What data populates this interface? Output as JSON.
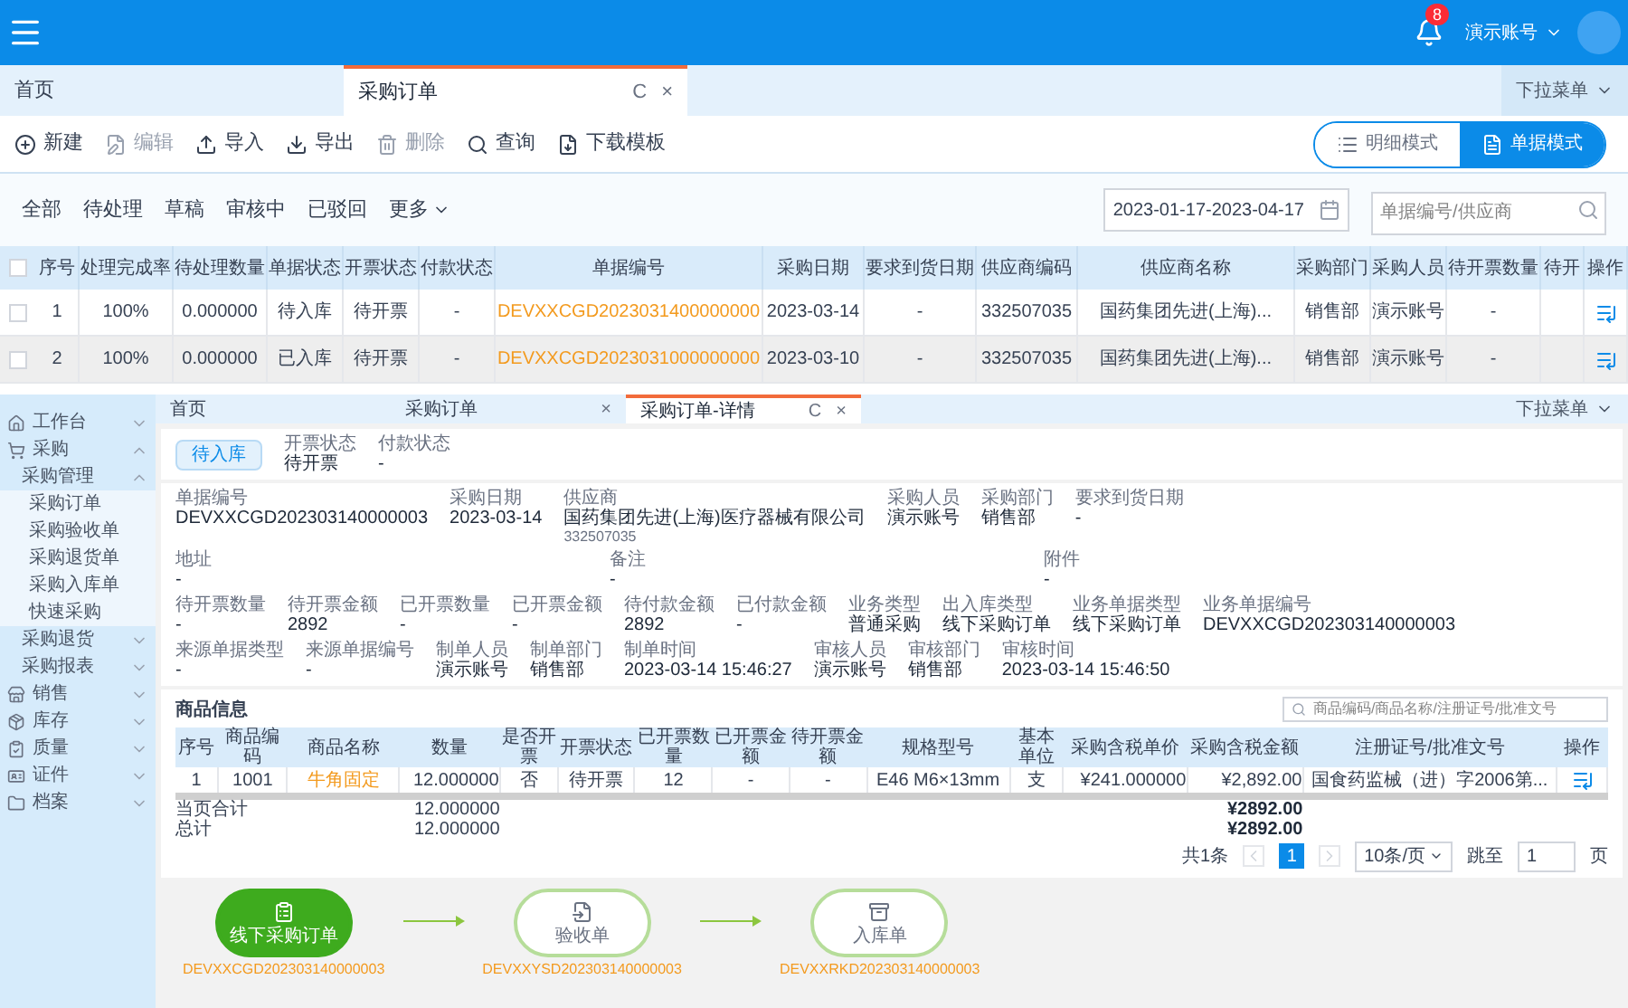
{
  "header": {
    "notification_count": "8",
    "user": "演示账号"
  },
  "tabs": [
    {
      "label": "首页",
      "selected": false
    },
    {
      "label": "采购订单",
      "selected": true,
      "refresh": "C",
      "close": "×"
    }
  ],
  "tab_menu": "下拉菜单",
  "toolbar": [
    {
      "label": "新建",
      "disabled": false
    },
    {
      "label": "编辑",
      "disabled": true
    },
    {
      "label": "导入",
      "disabled": false
    },
    {
      "label": "导出",
      "disabled": false
    },
    {
      "label": "删除",
      "disabled": true
    },
    {
      "label": "查询",
      "disabled": false
    },
    {
      "label": "下载模板",
      "disabled": false
    }
  ],
  "view_modes": [
    {
      "label": "明细模式",
      "selected": false
    },
    {
      "label": "单据模式",
      "selected": true
    }
  ],
  "filters": [
    {
      "label": "全部",
      "kind": "plain"
    },
    {
      "label": "待处理",
      "kind": "plain"
    },
    {
      "label": "草稿",
      "kind": "plain"
    },
    {
      "label": "审核中",
      "kind": "plain"
    },
    {
      "label": "已驳回",
      "kind": "plain"
    },
    {
      "label": "更多",
      "kind": "menu"
    }
  ],
  "date_range": "2023-01-17-2023-04-17",
  "search": {
    "placeholder": "单据编号/供应商"
  },
  "table": {
    "all_checked": false,
    "columns": [
      {
        "label": "序号",
        "kind": "text"
      },
      {
        "label": "处理完成率",
        "kind": "text"
      },
      {
        "label": "待处理数量",
        "kind": "text"
      },
      {
        "label": "单据状态",
        "kind": "text"
      },
      {
        "label": "开票状态",
        "kind": "text"
      },
      {
        "label": "付款状态",
        "kind": "text"
      },
      {
        "label": "单据编号",
        "kind": "link"
      },
      {
        "label": "采购日期",
        "kind": "text"
      },
      {
        "label": "要求到货日期",
        "kind": "text"
      },
      {
        "label": "供应商编码",
        "kind": "text"
      },
      {
        "label": "供应商名称",
        "kind": "text"
      },
      {
        "label": "采购部门",
        "kind": "text"
      },
      {
        "label": "采购人员",
        "kind": "text"
      },
      {
        "label": "待开票数量",
        "kind": "text"
      },
      {
        "label": "待开",
        "kind": "text"
      },
      {
        "label": "操作",
        "kind": "action"
      }
    ],
    "rows": [
      {
        "checked": false,
        "selected": false,
        "cells": [
          "1",
          "100%",
          "0.000000",
          "待入库",
          "待开票",
          "-",
          "DEVXXCGD2023031400000000",
          "2023-03-14",
          "-",
          "332507035",
          "国药集团先进(上海)...",
          "销售部",
          "演示账号",
          "-",
          ""
        ]
      },
      {
        "checked": false,
        "selected": true,
        "cells": [
          "2",
          "100%",
          "0.000000",
          "已入库",
          "待开票",
          "-",
          "DEVXXCGD2023031000000000",
          "2023-03-10",
          "-",
          "332507035",
          "国药集团先进(上海)...",
          "销售部",
          "演示账号",
          "-",
          ""
        ]
      }
    ]
  },
  "detail": {
    "tabs": [
      {
        "label": "首页",
        "selected": false
      },
      {
        "label": "采购订单",
        "selected": false,
        "close": "×"
      },
      {
        "label": "采购订单-详情",
        "selected": true,
        "refresh": "C",
        "close": "×"
      }
    ],
    "tab_menu": "下拉菜单",
    "sidebar": [
      {
        "label": "工作台",
        "expanded": false
      },
      {
        "label": "采购",
        "expanded": true,
        "children": [
          {
            "label": "采购管理",
            "expanded": true,
            "children": [
              {
                "label": "采购订单"
              },
              {
                "label": "采购验收单"
              },
              {
                "label": "采购退货单"
              },
              {
                "label": "采购入库单"
              },
              {
                "label": "快速采购"
              }
            ]
          },
          {
            "label": "采购退货",
            "expanded": false
          },
          {
            "label": "采购报表",
            "expanded": false
          }
        ]
      },
      {
        "label": "销售",
        "expanded": false
      },
      {
        "label": "库存",
        "expanded": false
      },
      {
        "label": "质量",
        "expanded": false
      },
      {
        "label": "证件",
        "expanded": false
      },
      {
        "label": "档案",
        "expanded": false
      }
    ],
    "status": {
      "tag": "待入库",
      "fields": [
        {
          "label": "开票状态",
          "value": "待开票"
        },
        {
          "label": "付款状态",
          "value": "-"
        }
      ]
    },
    "info_rows": [
      [
        {
          "label": "单据编号",
          "value": "DEVXXCGD202303140000003"
        },
        {
          "label": "采购日期",
          "value": "2023-03-14"
        },
        {
          "label": "供应商",
          "value": "国药集团先进(上海)医疗器械有限公司",
          "sub": "332507035"
        },
        {
          "label": "采购人员",
          "value": "演示账号"
        },
        {
          "label": "采购部门",
          "value": "销售部"
        },
        {
          "label": "要求到货日期",
          "value": "-"
        }
      ],
      [
        {
          "label": "地址",
          "value": "-"
        },
        {
          "label": "备注",
          "value": "-"
        },
        {
          "label": "附件",
          "value": "-"
        }
      ],
      [
        {
          "label": "待开票数量",
          "value": "-"
        },
        {
          "label": "待开票金额",
          "value": "2892"
        },
        {
          "label": "已开票数量",
          "value": "-"
        },
        {
          "label": "已开票金额",
          "value": "-"
        },
        {
          "label": "待付款金额",
          "value": "2892"
        },
        {
          "label": "已付款金额",
          "value": "-"
        },
        {
          "label": "业务类型",
          "value": "普通采购"
        },
        {
          "label": "出入库类型",
          "value": "线下采购订单"
        },
        {
          "label": "业务单据类型",
          "value": "线下采购订单"
        },
        {
          "label": "业务单据编号",
          "value": "DEVXXCGD202303140000003"
        }
      ],
      [
        {
          "label": "来源单据类型",
          "value": "-"
        },
        {
          "label": "来源单据编号",
          "value": "-"
        },
        {
          "label": "制单人员",
          "value": "演示账号"
        },
        {
          "label": "制单部门",
          "value": "销售部"
        },
        {
          "label": "制单时间",
          "value": "2023-03-14 15:46:27"
        },
        {
          "label": "审核人员",
          "value": "演示账号"
        },
        {
          "label": "审核部门",
          "value": "销售部"
        },
        {
          "label": "审核时间",
          "value": "2023-03-14 15:46:50"
        }
      ]
    ],
    "goods": {
      "title": "商品信息",
      "search": {
        "placeholder": "商品编码/商品名称/注册证号/批准文号"
      },
      "columns": [
        {
          "label": "序号",
          "kind": "text"
        },
        {
          "label": "商品编码",
          "kind": "text"
        },
        {
          "label": "商品名称",
          "kind": "link"
        },
        {
          "label": "数量",
          "kind": "num"
        },
        {
          "label": "是否开票",
          "kind": "text"
        },
        {
          "label": "开票状态",
          "kind": "text"
        },
        {
          "label": "已开票数量",
          "kind": "text"
        },
        {
          "label": "已开票金额",
          "kind": "text"
        },
        {
          "label": "待开票金额",
          "kind": "text"
        },
        {
          "label": "规格型号",
          "kind": "text"
        },
        {
          "label": "基本单位",
          "kind": "text"
        },
        {
          "label": "采购含税单价",
          "kind": "num"
        },
        {
          "label": "采购含税金额",
          "kind": "num"
        },
        {
          "label": "注册证号/批准文号",
          "kind": "text"
        },
        {
          "label": "操作",
          "kind": "action"
        }
      ],
      "rows": [
        {
          "cells": [
            "1",
            "1001",
            "牛角固定",
            "12.000000",
            "否",
            "待开票",
            "12",
            "-",
            "-",
            "E46 M6×13mm",
            "支",
            "¥241.000000",
            "¥2,892.00",
            "国食药监械（进）字2006第...",
            ""
          ]
        }
      ],
      "totals": [
        {
          "label": "当页合计",
          "quantity": "12.000000",
          "amount": "¥2892.00"
        },
        {
          "label": "总计",
          "quantity": "12.000000",
          "amount": "¥2892.00"
        }
      ],
      "pagination": {
        "total": "共1条",
        "pages": [
          {
            "label": "1",
            "selected": true
          }
        ],
        "page_size": "10条/页",
        "jump_label": "跳至",
        "jump_value": "1",
        "unit": "页"
      }
    },
    "flow": [
      {
        "label": "线下采购订单",
        "code": "DEVXXCGD202303140000003",
        "done": true
      },
      {
        "label": "验收单",
        "code": "DEVXXYSD202303140000003",
        "done": false
      },
      {
        "label": "入库单",
        "code": "DEVXXRKD202303140000003",
        "done": false
      }
    ]
  }
}
